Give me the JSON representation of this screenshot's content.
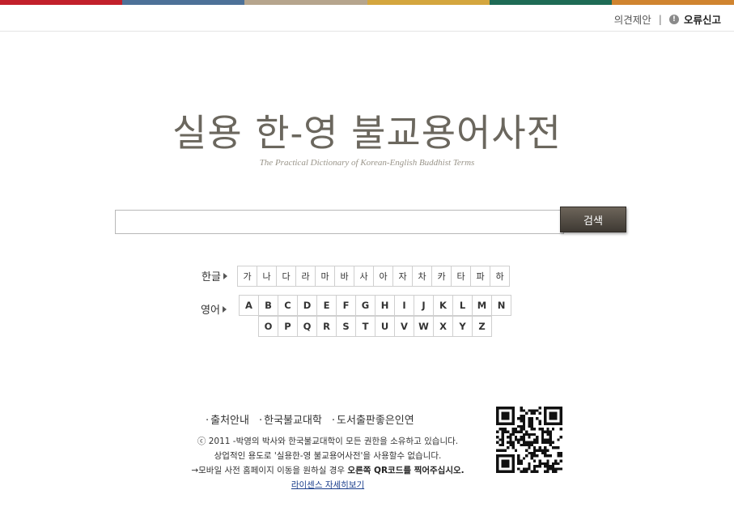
{
  "top_bar_colors": [
    "#c2202b",
    "#4d7198",
    "#b6a58d",
    "#d4a63e",
    "#1e6b55",
    "#d08430"
  ],
  "header": {
    "feedback": "의견제안",
    "separator": "|",
    "report_icon": "exclamation-icon",
    "report_error": "오류신고"
  },
  "title": "실용 한-영 불교용어사전",
  "subtitle": "The Practical Dictionary of Korean-English Buddhist Terms",
  "search": {
    "value": "",
    "button_label": "검색"
  },
  "index": {
    "hangul_label": "한글",
    "english_label": "영어",
    "hangul_keys": [
      "가",
      "나",
      "다",
      "라",
      "마",
      "바",
      "사",
      "아",
      "자",
      "차",
      "카",
      "타",
      "파",
      "하"
    ],
    "english_row1": [
      "A",
      "B",
      "C",
      "D",
      "E",
      "F",
      "G",
      "H",
      "I",
      "J",
      "K",
      "L",
      "M",
      "N"
    ],
    "english_row2": [
      "O",
      "P",
      "Q",
      "R",
      "S",
      "T",
      "U",
      "V",
      "W",
      "X",
      "Y",
      "Z"
    ]
  },
  "footer": {
    "links": [
      "출처안내",
      "한국불교대학",
      "도서출판좋은인연"
    ],
    "copyright": "ⓒ 2011 -박영의 박사와 한국불교대학이 모든 권한을 소유하고 있습니다.",
    "commercial": "상업적인 용도로 '실용한-영 불교용어사전'을 사용할수 없습니다.",
    "mobile_prefix": "→모바일 사전 홈페이지 이동을 원하실 경우",
    "mobile_emphasis": "오른쪽 QR코드를 찍어주십시오.",
    "license": "라이센스 자세히보기"
  }
}
